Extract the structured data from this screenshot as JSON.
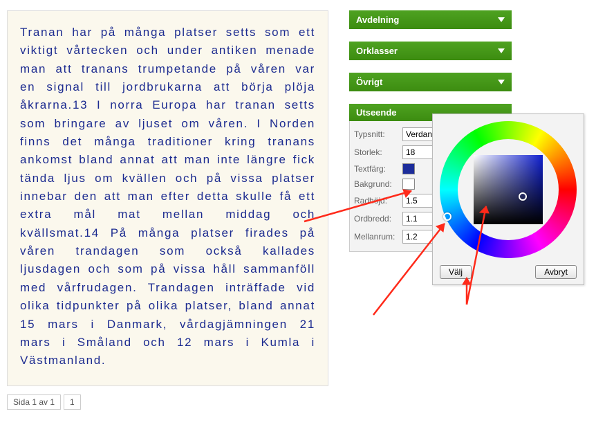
{
  "text_content": "Tranan har på många platser setts som ett viktigt vårtecken och under antiken menade man att tranans trumpetande på våren var en signal till jordbrukarna att börja plöja åkrarna.13 I norra Europa har tranan setts som bringare av ljuset om våren. I Norden finns det många traditioner kring tranans ankomst bland annat att man inte längre fick tända ljus om kvällen och på vissa platser innebar den att man efter detta skulle få ett extra mål mat mellan middag och kvällsmat.14 På många platser firades på våren trandagen som också kallades ljusdagen och som på vissa håll sammanföll med vårfrudagen. Trandagen inträffade vid olika tidpunkter på olika platser, bland annat 15 mars i Danmark, vårdagjämningen 21 mars i Småland och 12 mars i Kumla i Västmanland.",
  "pager": {
    "text": "Sida 1 av 1",
    "page": "1"
  },
  "accordions": {
    "avdelning": "Avdelning",
    "orklasser": "Orklasser",
    "ovrigt": "Övrigt"
  },
  "appearance": {
    "header": "Utseende",
    "labels": {
      "typsnitt": "Typsnitt:",
      "storlek": "Storlek:",
      "textfarg": "Textfärg:",
      "bakgrund": "Bakgrund:",
      "radhojd": "Radhöjd:",
      "ordbredd": "Ordbredd:",
      "mellanrum": "Mellanrum:"
    },
    "values": {
      "typsnitt": "Verdana",
      "storlek": "18",
      "radhojd": "1.5",
      "ordbredd": "1.1",
      "mellanrum": "1.2"
    },
    "colors": {
      "text": "#1c2c9a",
      "bg": "#ffffff"
    }
  },
  "popup": {
    "valj": "Välj",
    "avbryt": "Avbryt"
  }
}
